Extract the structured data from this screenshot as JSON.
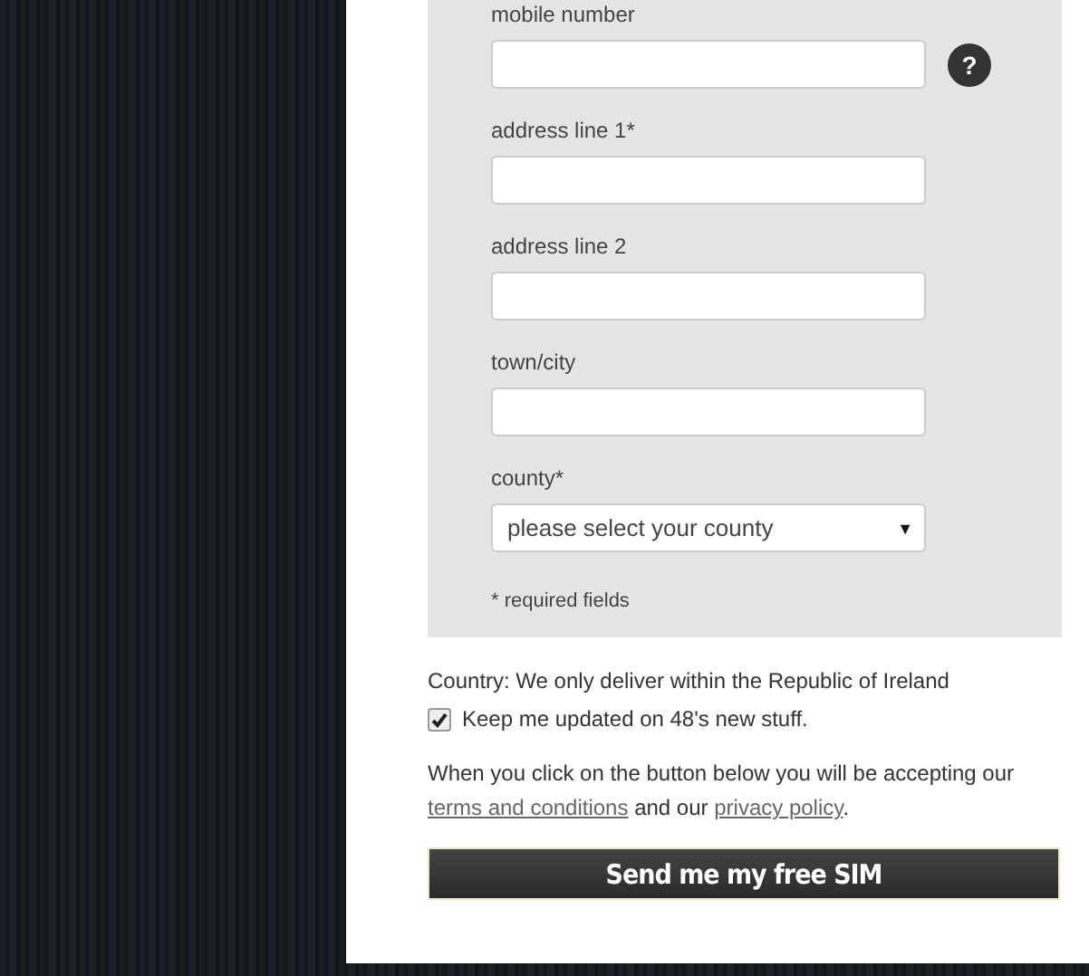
{
  "fields": [
    {
      "kind": "text",
      "label": "mobile number",
      "help": "?"
    },
    {
      "kind": "text",
      "label": "address line 1*"
    },
    {
      "kind": "text",
      "label": "address line 2"
    },
    {
      "kind": "text",
      "label": "town/city"
    },
    {
      "kind": "select",
      "label": "county*",
      "placeholder": "please select your county",
      "caret": "▼"
    }
  ],
  "required_note": "* required fields",
  "country_note": "Country: We only deliver within the Republic of Ireland",
  "newsletter": {
    "label": "Keep me updated on 48's new stuff.",
    "checked": true
  },
  "consent": [
    {
      "kind": "text",
      "text": "When you click on the button below you will be accepting our "
    },
    {
      "kind": "link",
      "text": "terms and conditions"
    },
    {
      "kind": "text",
      "text": " and our "
    },
    {
      "kind": "link",
      "text": "privacy policy"
    },
    {
      "kind": "text",
      "text": "."
    }
  ],
  "submit": "Send me my free SIM"
}
